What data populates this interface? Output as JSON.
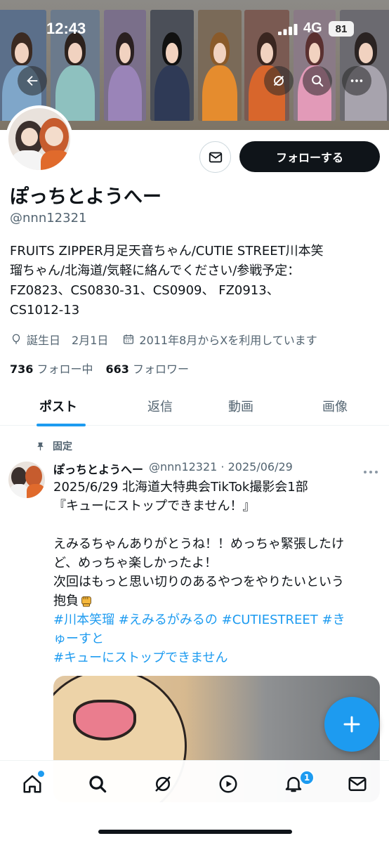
{
  "status_bar": {
    "time": "12:43",
    "network": "4G",
    "battery": "81"
  },
  "profile": {
    "name": "ぽっちとようへー",
    "handle": "@nnn12321",
    "follow_label": "フォローする",
    "bio_lines": [
      "FRUITS ZIPPER月足天音ちゃん/CUTIE STREET川本笑",
      "瑠ちゃん/北海道/気軽に絡んでください/参戦予定：",
      "FZ0823、CS0830-31、CS0909、 FZ0913、",
      "CS1012-13"
    ],
    "birthday_label": "誕生日",
    "birthday": "2月1日",
    "joined": "2011年8月からXを利用しています",
    "following_count": "736",
    "following_label": "フォロー中",
    "followers_count": "663",
    "followers_label": "フォロワー"
  },
  "tabs": [
    "ポスト",
    "返信",
    "動画",
    "画像"
  ],
  "post": {
    "pinned_label": "固定",
    "author_name": "ぽっちとようへー",
    "author_meta": "@nnn12321 · 2025/06/29",
    "lines": [
      "2025/6/29 北海道大特典会TikTok撮影会1部",
      "『キューにストップできません！』",
      "",
      "えみるちゃんありがとうね！！めっちゃ緊張したけ",
      "ど、めっちゃ楽しかったよ！",
      "次回はもっと思い切りのあるやつをやりたいという",
      "抱負"
    ],
    "hashtag_lines": [
      "#川本笑瑠 #えみるがみるの #CUTIESTREET #き",
      "ゅーすと",
      "#キューにストップできません"
    ]
  },
  "bottom_nav": {
    "items": [
      "home-icon",
      "search-icon",
      "grok-icon",
      "video-icon",
      "notifications-icon",
      "messages-icon"
    ],
    "notification_badge": "1"
  },
  "colors": {
    "accent": "#1d9bf0",
    "text": "#0f1419",
    "secondary": "#536471"
  }
}
